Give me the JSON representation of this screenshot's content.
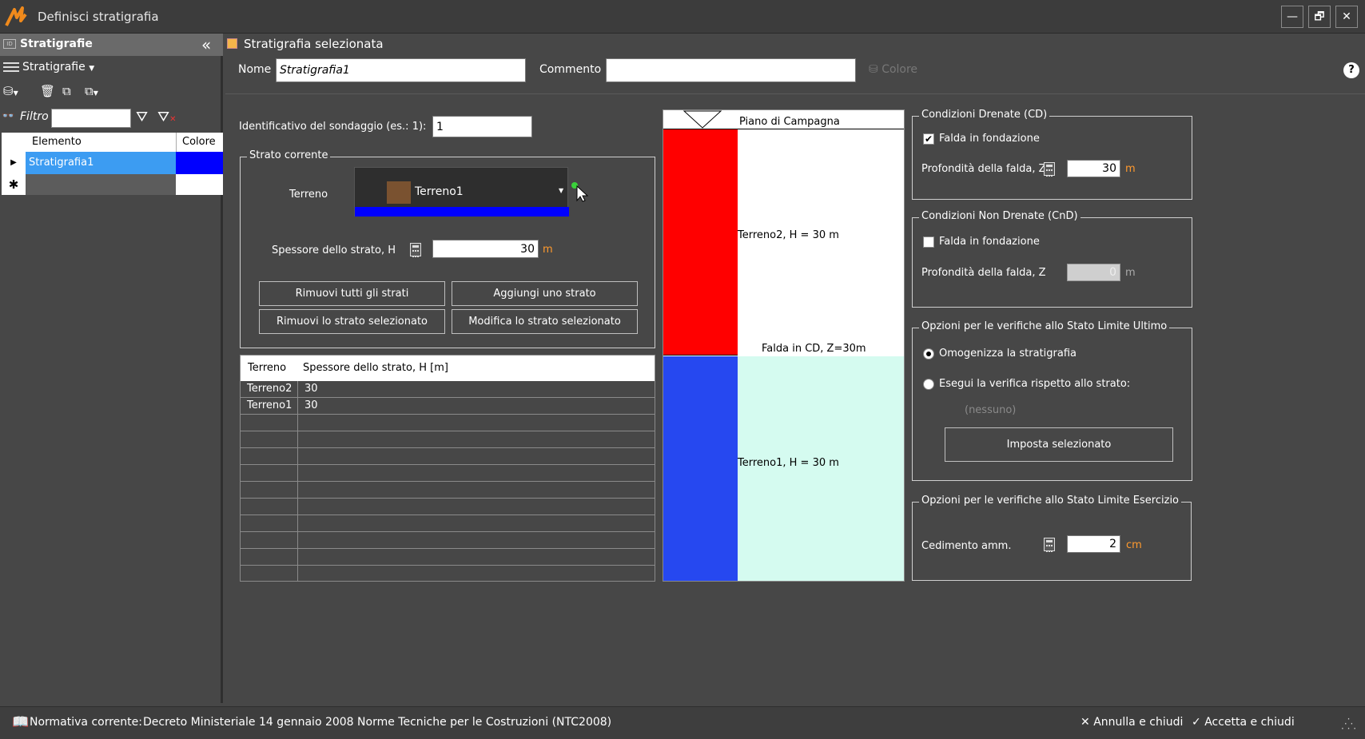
{
  "window": {
    "title": "Definisci stratigrafia",
    "buttons": {
      "minimize": "—",
      "restore": "🗗",
      "close": "✕"
    }
  },
  "left_panel": {
    "header": "Stratigrafie",
    "menu_label": "Stratigrafie",
    "filter_label": "Filtro",
    "filter_value": "",
    "grid": {
      "columns": [
        "Elemento",
        "Colore"
      ],
      "rows": [
        {
          "name": "Stratigrafia1",
          "color": "#0000ff"
        }
      ]
    }
  },
  "main": {
    "section_title": "Stratigrafia selezionata",
    "name_label": "Nome",
    "name_value": "Stratigrafia1",
    "comment_label": "Commento",
    "comment_value": "",
    "color_button": "Colore",
    "help": "?",
    "sondaggio_label": "Identificativo del sondaggio (es.: 1):",
    "sondaggio_value": "1",
    "strato": {
      "legend": "Strato corrente",
      "terreno_label": "Terreno",
      "terreno_value": "Terreno1",
      "terreno_swatch": "#7a5230",
      "terreno_bar": "#0000ff",
      "spessore_label": "Spessore dello strato, H",
      "spessore_value": "30",
      "spessore_unit": "m",
      "buttons": {
        "remove_all": "Rimuovi tutti gli strati",
        "add": "Aggiungi uno strato",
        "remove_selected": "Rimuovi lo strato selezionato",
        "edit_selected": "Modifica lo strato selezionato"
      }
    },
    "layers_table": {
      "columns": [
        "Terreno",
        "Spessore dello strato, H [m]"
      ],
      "rows": [
        [
          "Terreno2",
          "30"
        ],
        [
          "Terreno1",
          "30"
        ]
      ]
    },
    "profile": {
      "ground_label": "Piano di Campagna",
      "water_label": "Falda in CD, Z=30m",
      "layers": [
        {
          "label": "Terreno2, H =  30 m",
          "thickness": 30,
          "color": "#ff0000",
          "bg": "#ffffff"
        },
        {
          "label": "Terreno1, H =  30 m",
          "thickness": 30,
          "color": "#2648f0",
          "bg": "#d5fbf0"
        }
      ]
    },
    "cd": {
      "legend": "Condizioni Drenate (CD)",
      "falda_label": "Falda in fondazione",
      "falda_checked": true,
      "prof_label": "Profondità della falda, Z",
      "prof_value": "30",
      "prof_unit": "m"
    },
    "cnd": {
      "legend": "Condizioni Non Drenate (CnD)",
      "falda_label": "Falda in fondazione",
      "falda_checked": false,
      "prof_label": "Profondità della falda, Z",
      "prof_value": "0",
      "prof_unit": "m"
    },
    "slu": {
      "legend": "Opzioni per le verifiche allo Stato Limite Ultimo",
      "opt1": "Omogenizza la stratigrafia",
      "opt2": "Esegui la verifica rispetto allo strato:",
      "none": "(nessuno)",
      "button": "Imposta selezionato"
    },
    "sle": {
      "legend": "Opzioni per le verifiche allo Stato Limite Esercizio",
      "ced_label": "Cedimento amm.",
      "ced_value": "2",
      "ced_unit": "cm"
    }
  },
  "status": {
    "normativa_label": "Normativa corrente:",
    "normativa_value": "Decreto Ministeriale 14 gennaio 2008 Norme Tecniche per le Costruzioni (NTC2008)",
    "cancel": "Annulla e chiudi",
    "accept": "Accetta e chiudi"
  }
}
